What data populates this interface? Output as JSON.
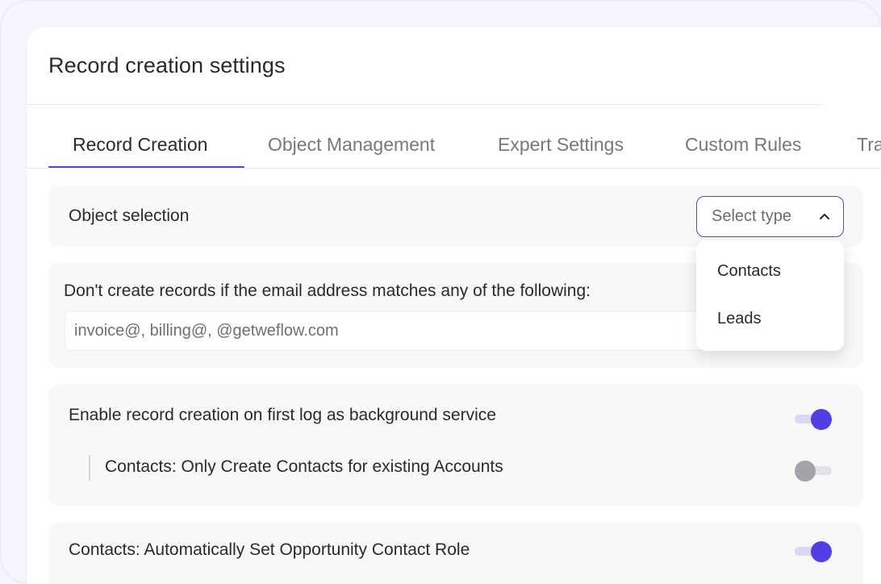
{
  "header": {
    "title": "Record creation settings"
  },
  "tabs": [
    {
      "label": "Record Creation",
      "active": true
    },
    {
      "label": "Object Management",
      "active": false
    },
    {
      "label": "Expert Settings",
      "active": false
    },
    {
      "label": "Custom Rules",
      "active": false
    },
    {
      "label": "Tra",
      "active": false
    }
  ],
  "object_selection": {
    "label": "Object selection",
    "select": {
      "value": "Select type",
      "open": true,
      "options": [
        "Contacts",
        "Leads"
      ]
    }
  },
  "email_exclusion": {
    "label": "Don't create records if the email address matches any of the following:",
    "value": "invoice@, billing@, @getweflow.com"
  },
  "settings": {
    "first_log": {
      "label": "Enable record creation on first log as background service",
      "enabled": true
    },
    "existing_accounts": {
      "label": "Contacts: Only Create Contacts for existing Accounts",
      "enabled": false
    },
    "contact_role": {
      "label": "Contacts: Automatically Set Opportunity Contact Role",
      "enabled": true
    }
  },
  "colors": {
    "accent": "#5046d6",
    "toggle_on": "#4f3fe4",
    "toggle_off": "#a2a3a8",
    "panel_bg": "#f8f8f9"
  }
}
